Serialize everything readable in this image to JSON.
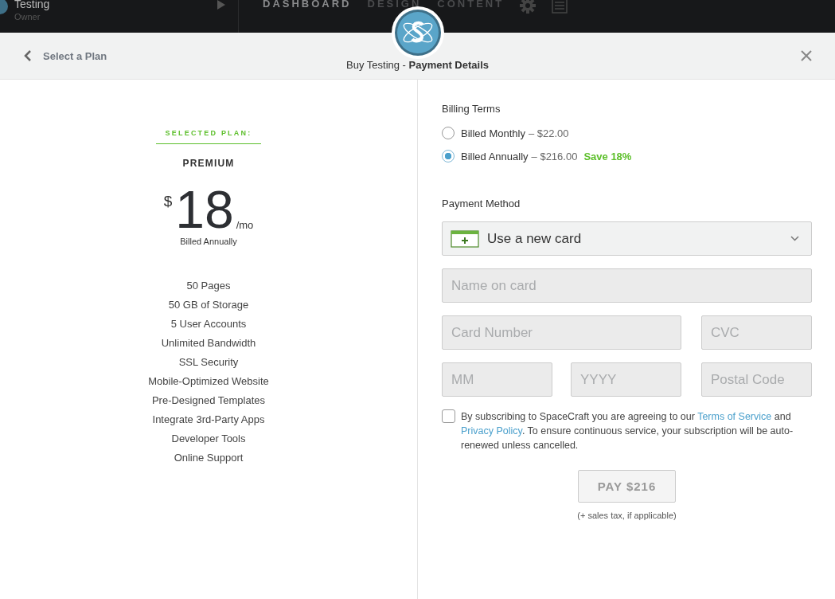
{
  "top_nav": {
    "account": {
      "name": "Testing",
      "role": "Owner"
    },
    "items": [
      {
        "label": "DASHBOARD",
        "selected": true
      },
      {
        "label": "DESIGN",
        "selected": false
      },
      {
        "label": "CONTENT",
        "selected": false
      }
    ]
  },
  "header": {
    "back_label": "Select a Plan",
    "title": "Buy Testing - **Payment Details**"
  },
  "plan": {
    "heading": "SELECTED PLAN:",
    "name": "PREMIUM",
    "currency": "$",
    "price": "18",
    "period": "/mo",
    "billing_note": "Billed Annually",
    "features": [
      "50 Pages",
      "50 GB of Storage",
      "5 User Accounts",
      "Unlimited Bandwidth",
      "SSL Security",
      "Mobile-Optimized Website",
      "Pre-Designed Templates",
      "Integrate 3rd-Party Apps",
      "Developer Tools",
      "Online Support"
    ]
  },
  "billing": {
    "title": "Billing Terms",
    "options": [
      {
        "label": "Billed Monthly",
        "price": "– $22.00",
        "selected": false
      },
      {
        "label": "Billed Annually",
        "price": "– $216.00",
        "note": "Save 18%",
        "selected": true
      }
    ]
  },
  "payment": {
    "title": "Payment Method",
    "method": "Use a new card",
    "field_rows": [
      [
        {
          "placeholder": "Name on card"
        }
      ],
      [
        {
          "placeholder": "Card Number"
        },
        {
          "placeholder": "CVC"
        }
      ],
      [
        {
          "placeholder": "MM"
        },
        {
          "placeholder": "YYYY"
        },
        {
          "placeholder": "Postal Code"
        }
      ]
    ]
  },
  "terms": {
    "checked": false,
    "parts": [
      {
        "kind": "text",
        "text": "By subscribing to SpaceCraft you are agreeing to our "
      },
      {
        "kind": "link",
        "text": "Terms of Service"
      },
      {
        "kind": "text",
        "text": " and "
      },
      {
        "kind": "link",
        "text": "Privacy Policy"
      },
      {
        "kind": "text",
        "text": ". To ensure continuous service, your subscription will be auto-renewed unless cancelled."
      }
    ]
  },
  "pay_button": {
    "label": "PAY $216",
    "disabled": true
  },
  "tax_note": "(+ sales tax, if applicable)"
}
